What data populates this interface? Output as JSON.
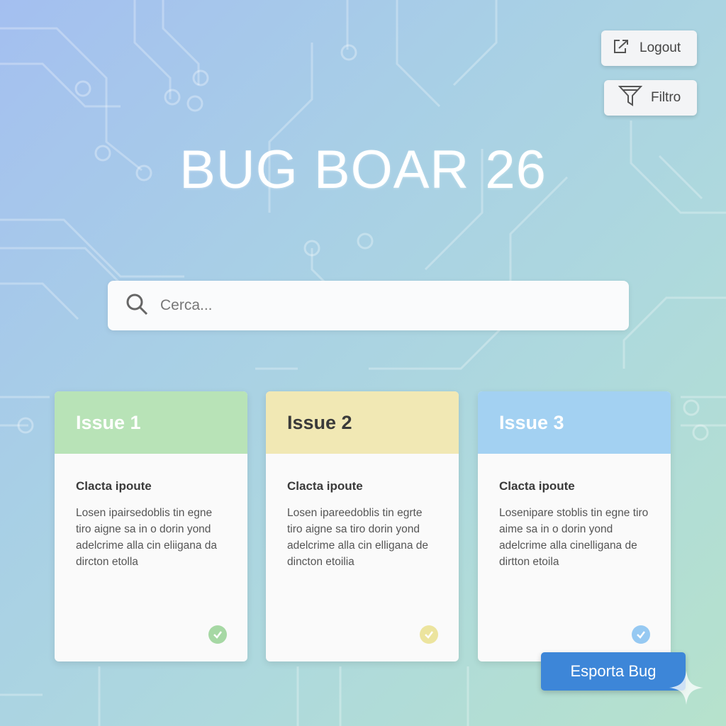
{
  "header": {
    "title": "BUG BOAR 26",
    "logout_label": "Logout",
    "filter_label": "Filtro"
  },
  "search": {
    "placeholder": "Cerca..."
  },
  "cards": [
    {
      "title": "Issue 1",
      "subtitle": "Clacta ipoute",
      "body": "Losen ipairsedoblis tin egne tiro aigne sa in o dorin yond adelcrime alla cin eliigana da dircton etolla",
      "accent": "#b8e3b7",
      "title_color": "#ffffff",
      "check_color": "#a6d8a4"
    },
    {
      "title": "Issue 2",
      "subtitle": "Clacta ipoute",
      "body": "Losen ipareedoblis tin egrte tiro aigne sa tiro dorin yond adelcrime alla cin elligana de dincton etoilia",
      "accent": "#f1e8b4",
      "title_color": "#3a3a3a",
      "check_color": "#ece49e"
    },
    {
      "title": "Issue 3",
      "subtitle": "Clacta ipoute",
      "body": "Losenipare stoblis tin egne tiro aime sa in o dorin yond adelcrime alla cinelligana de dirtton etoila",
      "accent": "#a3d1f2",
      "title_color": "#ffffff",
      "check_color": "#96c9f2"
    }
  ],
  "actions": {
    "export_label": "Esporta Bug"
  },
  "icons": {
    "logout": "logout-icon",
    "filter": "funnel-icon",
    "search": "search-icon",
    "check": "check-circle-icon",
    "sparkle": "sparkle-icon"
  }
}
